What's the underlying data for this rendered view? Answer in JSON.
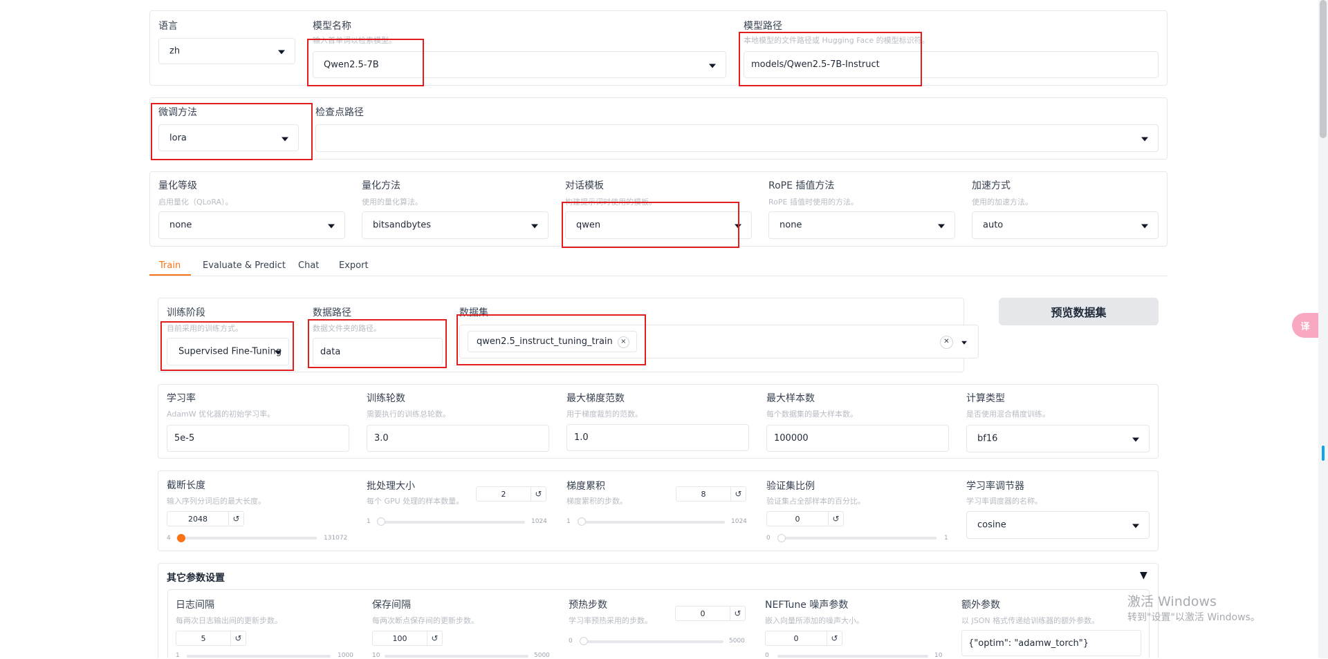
{
  "model": {
    "language": {
      "label": "语言",
      "value": "zh"
    },
    "model_name": {
      "label": "模型名称",
      "hint": "输入首单词以检索模型。",
      "value": "Qwen2.5-7B"
    },
    "model_path": {
      "label": "模型路径",
      "hint": "本地模型的文件路径或 Hugging Face 的模型标识符。",
      "value": "models/Qwen2.5-7B-Instruct"
    }
  },
  "finetune": {
    "method": {
      "label": "微调方法",
      "value": "lora"
    },
    "checkpoint": {
      "label": "检查点路径",
      "value": ""
    }
  },
  "advanced": {
    "quant_level": {
      "label": "量化等级",
      "hint": "启用量化（QLoRA）。",
      "value": "none"
    },
    "quant_method": {
      "label": "量化方法",
      "hint": "使用的量化算法。",
      "value": "bitsandbytes"
    },
    "template": {
      "label": "对话模板",
      "hint": "构建提示词时使用的模板。",
      "value": "qwen"
    },
    "rope": {
      "label": "RoPE 插值方法",
      "hint": "RoPE 插值时使用的方法。",
      "value": "none"
    },
    "booster": {
      "label": "加速方式",
      "hint": "使用的加速方法。",
      "value": "auto"
    }
  },
  "tabs": [
    "Train",
    "Evaluate & Predict",
    "Chat",
    "Export"
  ],
  "train": {
    "stage": {
      "label": "训练阶段",
      "hint": "目前采用的训练方式。",
      "value": "Supervised Fine-Tuning"
    },
    "dataset_dir": {
      "label": "数据路径",
      "hint": "数据文件夹的路径。",
      "value": "data"
    },
    "dataset": {
      "label": "数据集",
      "chip": "qwen2.5_instruct_tuning_train",
      "chip_close": "×",
      "clear": "✕"
    },
    "preview_button": "预览数据集",
    "learning_rate": {
      "label": "学习率",
      "hint": "AdamW 优化器的初始学习率。",
      "value": "5e-5"
    },
    "epochs": {
      "label": "训练轮数",
      "hint": "需要执行的训练总轮数。",
      "value": "3.0"
    },
    "max_grad_norm": {
      "label": "最大梯度范数",
      "hint": "用于梯度裁剪的范数。",
      "value": "1.0"
    },
    "max_samples": {
      "label": "最大样本数",
      "hint": "每个数据集的最大样本数。",
      "value": "100000"
    },
    "compute_type": {
      "label": "计算类型",
      "hint": "是否使用混合精度训练。",
      "value": "bf16"
    },
    "cutoff_len": {
      "label": "截断长度",
      "hint": "输入序列分词后的最大长度。",
      "value": "2048",
      "min": "4",
      "max": "131072",
      "level": 0.0156
    },
    "batch_size": {
      "label": "批处理大小",
      "hint": "每个 GPU 处理的样本数量。",
      "value": "2",
      "min": "1",
      "max": "1024",
      "level": 0.001
    },
    "grad_accum": {
      "label": "梯度累积",
      "hint": "梯度累积的步数。",
      "value": "8",
      "min": "1",
      "max": "1024",
      "level": 0.007
    },
    "val_size": {
      "label": "验证集比例",
      "hint": "验证集占全部样本的百分比。",
      "value": "0",
      "min": "0",
      "max": "1",
      "level": 0
    },
    "lr_scheduler": {
      "label": "学习率调节器",
      "hint": "学习率调度器的名称。",
      "value": "cosine"
    },
    "reset_icon": "↺"
  },
  "other": {
    "title": "其它参数设置",
    "toggle": "▼",
    "logging_steps": {
      "label": "日志间隔",
      "hint": "每两次日志输出间的更新步数。",
      "value": "5",
      "min": "1",
      "max": "1000"
    },
    "save_steps": {
      "label": "保存间隔",
      "hint": "每两次断点保存间的更新步数。",
      "value": "100",
      "min": "10",
      "max": "5000"
    },
    "warmup_steps": {
      "label": "预热步数",
      "hint": "学习率预热采用的步数。",
      "value": "0",
      "min": "0",
      "max": "5000"
    },
    "neftune": {
      "label": "NEFTune 噪声参数",
      "hint": "嵌入向量所添加的噪声大小。",
      "value": "0",
      "min": "0",
      "max": "10"
    },
    "extra_args": {
      "label": "额外参数",
      "hint": "以 JSON 格式传递给训练器的额外参数。",
      "value": "{\"optim\": \"adamw_torch\"}"
    }
  },
  "watermark": {
    "line1": "激活 Windows",
    "line2": "转到\"设置\"以激活 Windows。"
  },
  "translate_icon": "译",
  "colors": {
    "accent": "#f97316",
    "annotation": "#e11d1d",
    "border": "#e5e7eb"
  }
}
